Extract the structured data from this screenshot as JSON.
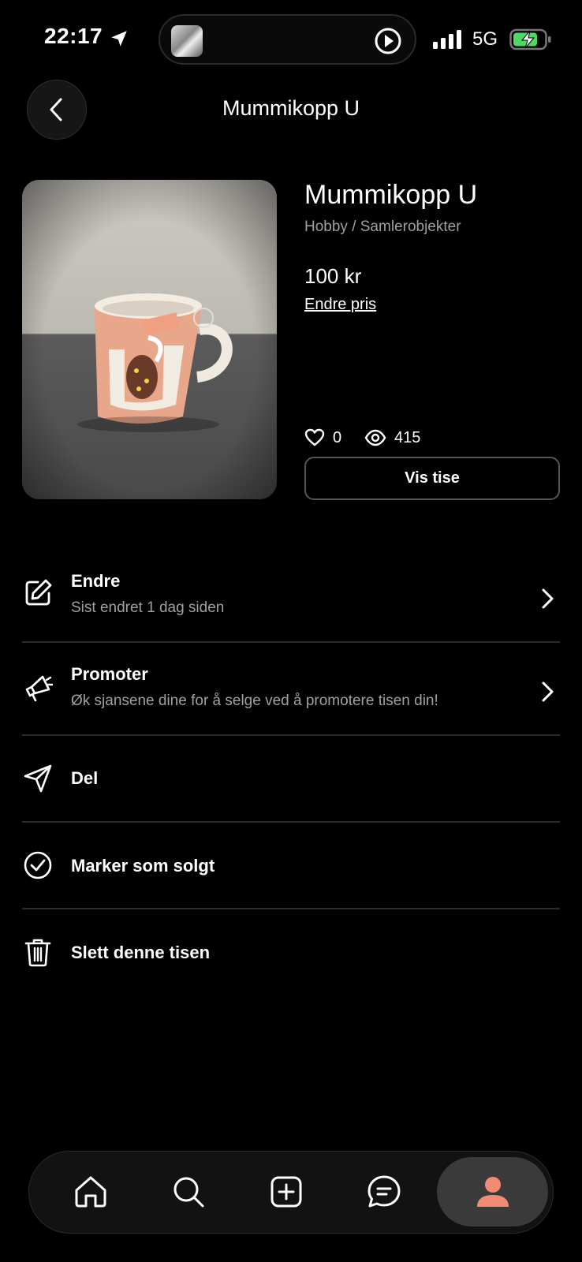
{
  "status_bar": {
    "time": "22:17",
    "network": "5G",
    "icons": [
      "location-arrow-icon",
      "now-playing-avatar",
      "play-icon",
      "signal-icon",
      "battery-charging-icon"
    ]
  },
  "header": {
    "title": "Mummikopp U",
    "back_icon": "chevron-left-icon"
  },
  "product": {
    "title": "Mummikopp U",
    "category": "Hobby / Samlerobjekter",
    "price": "100 kr",
    "change_price_label": "Endre pris",
    "likes": "0",
    "views": "415",
    "view_button_label": "Vis tise"
  },
  "actions": [
    {
      "icon": "edit-icon",
      "title": "Endre",
      "subtitle": "Sist endret 1 dag siden",
      "chevron": true
    },
    {
      "icon": "megaphone-icon",
      "title": "Promoter",
      "subtitle": "Øk sjansene dine for å selge ved å promotere tisen din!",
      "chevron": true
    },
    {
      "icon": "send-icon",
      "title": "Del"
    },
    {
      "icon": "check-circle-icon",
      "title": "Marker som solgt"
    },
    {
      "icon": "trash-icon",
      "title": "Slett denne tisen"
    }
  ],
  "tabbar": {
    "tabs": [
      "home-icon",
      "search-icon",
      "add-icon",
      "messages-icon",
      "profile-icon"
    ],
    "active": "profile-icon",
    "accent": "#f28b74"
  }
}
